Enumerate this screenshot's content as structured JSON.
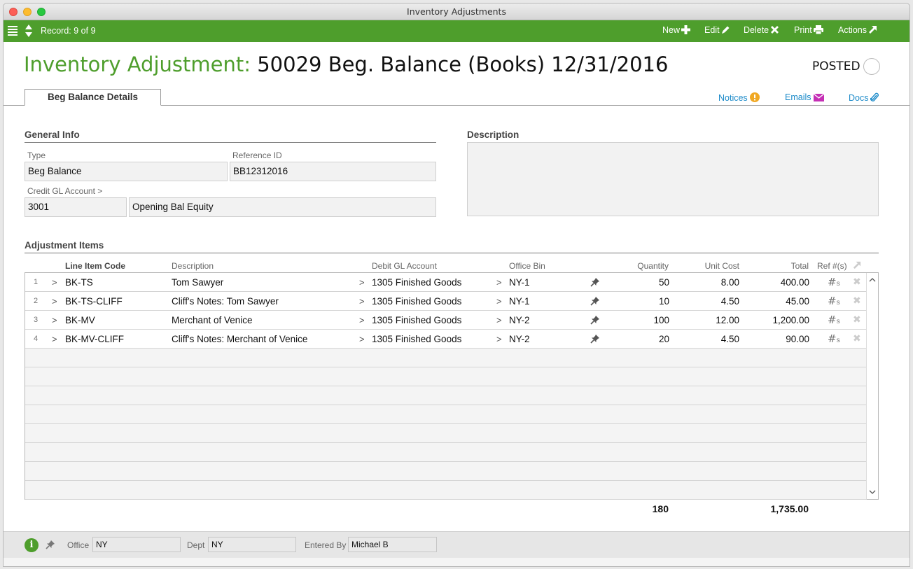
{
  "window": {
    "title": "Inventory Adjustments"
  },
  "toolbar": {
    "record": "Record: 9 of 9",
    "new_label": "New",
    "edit_label": "Edit",
    "delete_label": "Delete",
    "print_label": "Print",
    "actions_label": "Actions"
  },
  "header": {
    "title_lead": "Inventory Adjustment:",
    "title_rest": "50029 Beg. Balance (Books) 12/31/2016",
    "status": "POSTED"
  },
  "tabs": {
    "active": "Beg Balance Details"
  },
  "links": {
    "notices": "Notices",
    "emails": "Emails",
    "docs": "Docs"
  },
  "general": {
    "title": "General Info",
    "type_label": "Type",
    "type_value": "Beg Balance",
    "ref_label": "Reference ID",
    "ref_value": "BB12312016",
    "gl_label": "Credit GL Account >",
    "gl_code": "3001",
    "gl_name": "Opening Bal Equity"
  },
  "description": {
    "title": "Description",
    "value": ""
  },
  "items": {
    "title": "Adjustment Items",
    "headers": {
      "code": "Line Item Code",
      "desc": "Description",
      "gl": "Debit GL Account",
      "bin": "Office Bin",
      "qty": "Quantity",
      "cost": "Unit Cost",
      "total": "Total",
      "ref": "Ref #(s)"
    },
    "rows": [
      {
        "n": "1",
        "code": "BK-TS",
        "desc": "Tom Sawyer",
        "gl": "1305 Finished Goods",
        "bin": "NY-1",
        "qty": "50",
        "cost": "8.00",
        "total": "400.00"
      },
      {
        "n": "2",
        "code": "BK-TS-CLIFF",
        "desc": "Cliff's Notes: Tom Sawyer",
        "gl": "1305 Finished Goods",
        "bin": "NY-1",
        "qty": "10",
        "cost": "4.50",
        "total": "45.00"
      },
      {
        "n": "3",
        "code": "BK-MV",
        "desc": "Merchant of Venice",
        "gl": "1305 Finished Goods",
        "bin": "NY-2",
        "qty": "100",
        "cost": "12.00",
        "total": "1,200.00"
      },
      {
        "n": "4",
        "code": "BK-MV-CLIFF",
        "desc": "Cliff's Notes: Merchant of Venice",
        "gl": "1305 Finished Goods",
        "bin": "NY-2",
        "qty": "20",
        "cost": "4.50",
        "total": "90.00"
      }
    ],
    "total_qty": "180",
    "total_amount": "1,735.00"
  },
  "footer": {
    "office_label": "Office",
    "office_value": "NY",
    "dept_label": "Dept",
    "dept_value": "NY",
    "entered_label": "Entered By",
    "entered_value": "Michael B"
  },
  "colors": {
    "brand_green": "#4e9e2c",
    "link_blue": "#1b8ac9",
    "notice_orange": "#f0a824",
    "email_magenta": "#c52fb5"
  }
}
